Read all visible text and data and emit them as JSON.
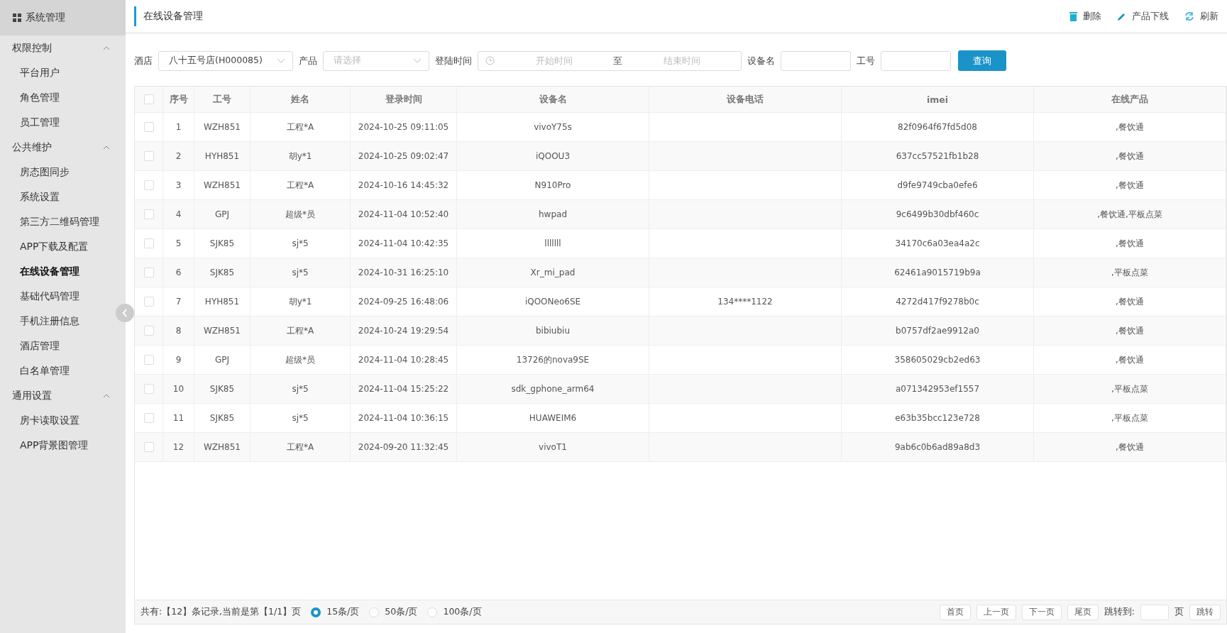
{
  "sidebar": {
    "title": "系统管理",
    "groups": [
      {
        "label": "权限控制",
        "expanded": true,
        "items": [
          {
            "label": "平台用户",
            "selected": false
          },
          {
            "label": "角色管理",
            "selected": false
          },
          {
            "label": "员工管理",
            "selected": false
          }
        ]
      },
      {
        "label": "公共维护",
        "expanded": true,
        "items": [
          {
            "label": "房态图同步",
            "selected": false
          },
          {
            "label": "系统设置",
            "selected": false
          },
          {
            "label": "第三方二维码管理",
            "selected": false
          },
          {
            "label": "APP下载及配置",
            "selected": false
          },
          {
            "label": "在线设备管理",
            "selected": true
          },
          {
            "label": "基础代码管理",
            "selected": false
          },
          {
            "label": "手机注册信息",
            "selected": false
          },
          {
            "label": "酒店管理",
            "selected": false
          },
          {
            "label": "白名单管理",
            "selected": false
          }
        ]
      },
      {
        "label": "通用设置",
        "expanded": true,
        "items": [
          {
            "label": "房卡读取设置",
            "selected": false
          },
          {
            "label": "APP背景图管理",
            "selected": false
          }
        ]
      }
    ]
  },
  "page": {
    "title": "在线设备管理",
    "actions": [
      {
        "kind": "delete",
        "label": "删除"
      },
      {
        "kind": "edit",
        "label": "产品下线"
      },
      {
        "kind": "refresh",
        "label": "刷新"
      }
    ]
  },
  "filters": {
    "hotel": {
      "label": "酒店",
      "value": "八十五号店(H000085)"
    },
    "product": {
      "label": "产品",
      "placeholder": "请选择"
    },
    "login_time": {
      "label": "登陆时间",
      "start_placeholder": "开始时间",
      "separator": "至",
      "end_placeholder": "结束时间"
    },
    "device_name": {
      "label": "设备名"
    },
    "employee_no": {
      "label": "工号"
    },
    "search_button": "查询"
  },
  "table": {
    "select_all": false,
    "columns": [
      "序号",
      "工号",
      "姓名",
      "登录时间",
      "设备名",
      "设备电话",
      "imei",
      "在线产品"
    ],
    "rows": [
      {
        "checked": false,
        "cells": [
          "1",
          "WZH851",
          "工程*A",
          "2024-10-25 09:11:05",
          "vivoY75s",
          "",
          "82f0964f67fd5d08",
          ",餐饮通"
        ]
      },
      {
        "checked": false,
        "cells": [
          "2",
          "HYH851",
          "胡y*1",
          "2024-10-25 09:02:47",
          "iQOOU3",
          "",
          "637cc57521fb1b28",
          ",餐饮通"
        ]
      },
      {
        "checked": false,
        "cells": [
          "3",
          "WZH851",
          "工程*A",
          "2024-10-16 14:45:32",
          "N910Pro",
          "",
          "d9fe9749cba0efe6",
          ",餐饮通"
        ]
      },
      {
        "checked": false,
        "cells": [
          "4",
          "GPJ",
          "超级*员",
          "2024-11-04 10:52:40",
          "hwpad",
          "",
          "9c6499b30dbf460c",
          ",餐饮通,平板点菜"
        ]
      },
      {
        "checked": false,
        "cells": [
          "5",
          "SJK85",
          "sj*5",
          "2024-11-04 10:42:35",
          "lllllll",
          "",
          "34170c6a03ea4a2c",
          ",餐饮通"
        ]
      },
      {
        "checked": false,
        "cells": [
          "6",
          "SJK85",
          "sj*5",
          "2024-10-31 16:25:10",
          "Xr_mi_pad",
          "",
          "62461a9015719b9a",
          ",平板点菜"
        ]
      },
      {
        "checked": false,
        "cells": [
          "7",
          "HYH851",
          "胡y*1",
          "2024-09-25 16:48:06",
          "iQOONeo6SE",
          "134****1122",
          "4272d417f9278b0c",
          ",餐饮通"
        ]
      },
      {
        "checked": false,
        "cells": [
          "8",
          "WZH851",
          "工程*A",
          "2024-10-24 19:29:54",
          "bibiubiu",
          "",
          "b0757df2ae9912a0",
          ",餐饮通"
        ]
      },
      {
        "checked": false,
        "cells": [
          "9",
          "GPJ",
          "超级*员",
          "2024-11-04 10:28:45",
          "13726的nova9SE",
          "",
          "358605029cb2ed63",
          ",餐饮通"
        ]
      },
      {
        "checked": false,
        "cells": [
          "10",
          "SJK85",
          "sj*5",
          "2024-11-04 15:25:22",
          "sdk_gphone_arm64",
          "",
          "a071342953ef1557",
          ",平板点菜"
        ]
      },
      {
        "checked": false,
        "cells": [
          "11",
          "SJK85",
          "sj*5",
          "2024-11-04 10:36:15",
          "HUAWEIM6",
          "",
          "e63b35bcc123e728",
          ",平板点菜"
        ]
      },
      {
        "checked": false,
        "cells": [
          "12",
          "WZH851",
          "工程*A",
          "2024-09-20 11:32:45",
          "vivoT1",
          "",
          "9ab6c0b6ad89a8d3",
          ",餐饮通"
        ]
      }
    ]
  },
  "footer": {
    "summary": "共有:【12】条记录,当前是第【1/1】页",
    "page_sizes": [
      {
        "label": "15条/页",
        "selected": true
      },
      {
        "label": "50条/页",
        "selected": false
      },
      {
        "label": "100条/页",
        "selected": false
      }
    ],
    "nav_buttons": [
      "首页",
      "上一页",
      "下一页",
      "尾页"
    ],
    "jump_label": "跳转到:",
    "jump_unit": "页",
    "jump_button": "跳转"
  }
}
